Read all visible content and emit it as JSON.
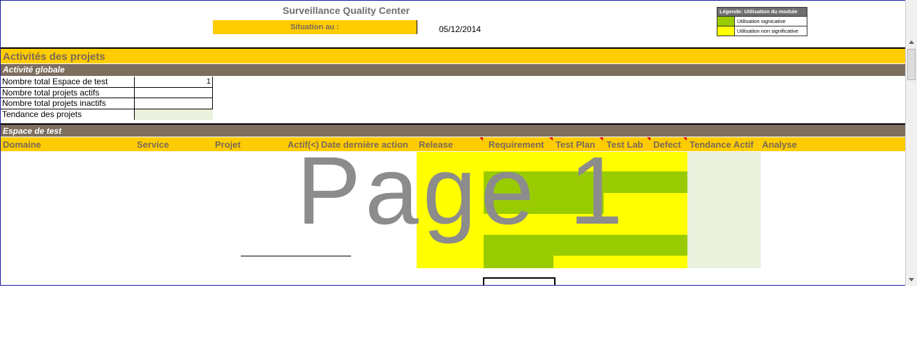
{
  "header": {
    "title": "Surveillance Quality Center",
    "situation_label": "Situation au :",
    "date": "05/12/2014"
  },
  "legend": {
    "title": "Légende: Utilisation du module",
    "items": [
      {
        "color": "#99cc00",
        "label": "Utilisation signicative"
      },
      {
        "color": "#ffff00",
        "label": "Utilisation non significative"
      }
    ]
  },
  "sections": {
    "activites": "Activités des projets",
    "globale": "Activité globale",
    "espace": "Espace de test"
  },
  "global_rows": [
    {
      "label": "Nombre total Espace de test",
      "value": "1"
    },
    {
      "label": "Nombre total projets actifs",
      "value": ""
    },
    {
      "label": "Nombre total projets inactifs",
      "value": ""
    },
    {
      "label": "Tendance des projets",
      "value": ""
    }
  ],
  "columns": {
    "domaine": "Domaine",
    "service": "Service",
    "projet": "Projet",
    "actif": "Actif(<)",
    "date": "Date dernière action",
    "release": "Release",
    "requirement": "Requirement",
    "testplan": "Test Plan",
    "testlab": "Test Lab",
    "defect": "Defect",
    "tendance": "Tendance Actif",
    "analyse": "Analyse"
  },
  "watermark": "Page 1",
  "colors": {
    "orange": "#ffcc00",
    "brown": "#7d6e5e",
    "green": "#99cc00",
    "yellow": "#ffff00",
    "light_green": "#eaf1dd"
  }
}
